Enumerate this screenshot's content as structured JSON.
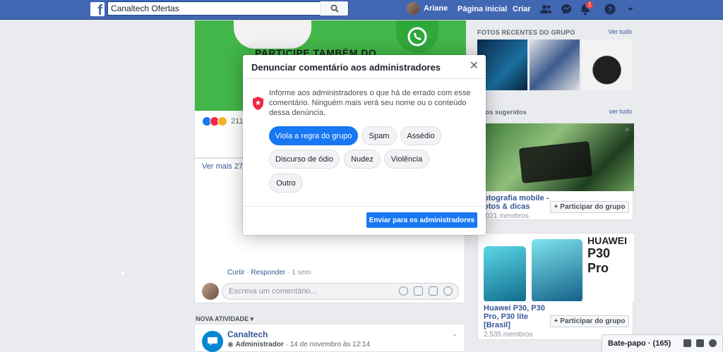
{
  "topbar": {
    "search_value": "Canaltech Ofertas",
    "user_name": "Ariane",
    "home": "Página inicial",
    "create": "Criar",
    "notif_count": "1"
  },
  "feed": {
    "banner_text": "PARTICIPE TAMBÉM DO",
    "reaction_count": "211",
    "see_more": "Ver mais 27 c",
    "comment_actions": {
      "like": "Curtir",
      "reply": "Responder",
      "time": "1 sem"
    },
    "comment_placeholder": "Escreva um comentário...",
    "new_activity": "NOVA ATIVIDADE",
    "post": {
      "author": "Canaltech",
      "role": "Administrador",
      "date": "14 de novembro às 12:14"
    }
  },
  "right": {
    "photos_title": "FOTOS RECENTES DO GRUPO",
    "see_all_1": "Ver tudo",
    "suggested_title": "upos sugeridos",
    "see_all_2": "ver tudo",
    "groups": [
      {
        "name1": "otografia mobile -",
        "name2": "otos & dicas",
        "members": ".021 membros",
        "join": "Participar do grupo"
      },
      {
        "name1": "Huawei P30, P30",
        "name2": "Pro, P30 lite",
        "name3": "[Brasil]",
        "members": "2.535 membros",
        "join": "Participar do grupo"
      }
    ],
    "ad_brand": "HUAWEI",
    "ad_model": "P30 Pro"
  },
  "chat": {
    "label": "Bate-papo · (165)"
  },
  "modal": {
    "title": "Denunciar comentário aos administradores",
    "description": "Informe aos administradores o que há de errado com esse comentário. Ninguém mais verá seu nome ou o conteúdo dessa denúncia.",
    "options": [
      "Viola a regra do grupo",
      "Spam",
      "Assédio",
      "Discurso de ódio",
      "Nudez",
      "Violência",
      "Outro"
    ],
    "selected_index": 0,
    "submit": "Enviar para os administradores"
  },
  "colors": {
    "brand": "#4267b2",
    "accent": "#1877f2"
  }
}
